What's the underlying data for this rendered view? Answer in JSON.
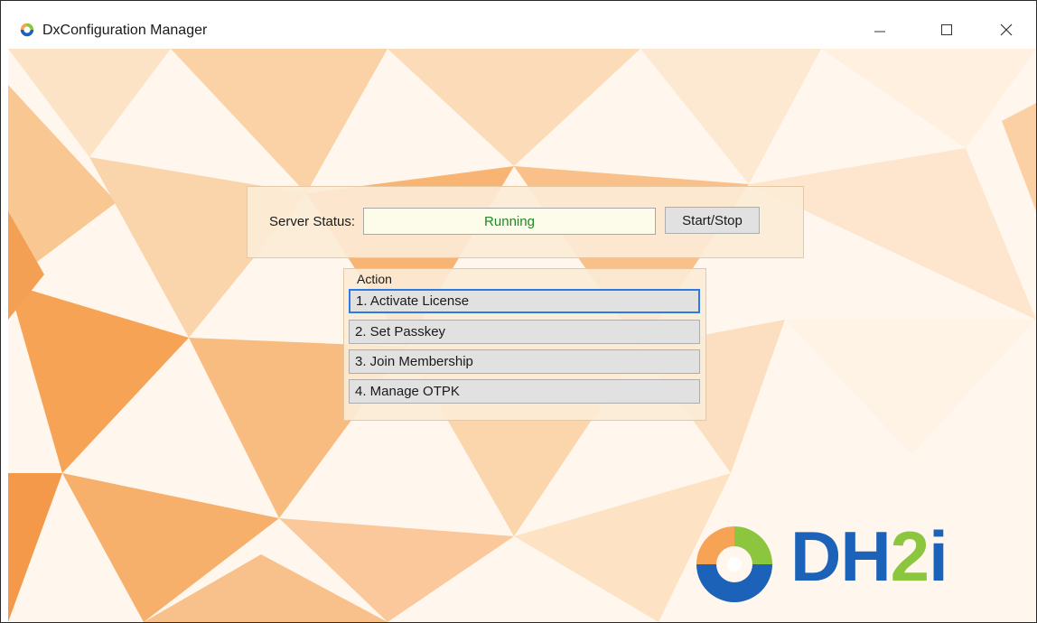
{
  "window": {
    "title": "DxConfiguration Manager",
    "controls": [
      "minimize-icon",
      "maximize-icon",
      "close-icon"
    ]
  },
  "server_status": {
    "label": "Server Status:",
    "value": "Running",
    "value_color": "#1b8a27",
    "button_label": "Start/Stop"
  },
  "action": {
    "legend": "Action",
    "buttons": [
      {
        "label": "1. Activate License",
        "focused": true
      },
      {
        "label": "2. Set Passkey"
      },
      {
        "label": "3. Join Membership"
      },
      {
        "label": "4. Manage OTPK"
      }
    ]
  },
  "logo": {
    "text_a": "DH",
    "text_b": "2",
    "text_c": "i",
    "color_primary": "#1b62b8",
    "color_accent": "#8cc63f"
  },
  "colors": {
    "background_orange": "#f6a356",
    "panel_bg": "#fcecd6",
    "focus_border": "#2c7be5"
  }
}
